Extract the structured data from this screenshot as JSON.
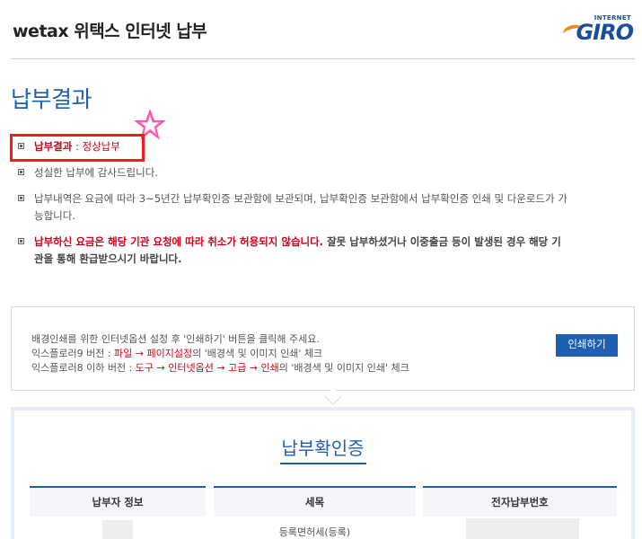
{
  "header": {
    "title": "wetax 위택스 인터넷 납부",
    "logo_small": "INTERNET",
    "logo_main": "GIRO"
  },
  "page_title": "납부결과",
  "result": {
    "label": "납부결과",
    "separator": " : ",
    "value": "정상납부"
  },
  "notes": [
    "성실한 납부에 감사드립니다.",
    "납부내역은 요금에 따라 3~5년간 납부확인증 보관함에 보관되며, 납부확인증 보관함에서 납부확인증 인쇄 및 다운로드가 가",
    "능합니다."
  ],
  "warning": {
    "part1": "납부하신 요금은 해당 기관 요청에 따라 취소가 허용되지 않습니다.",
    "part2": " 잘못 납부하셨거나 이중출금 등이 발생된 경우 해당 기",
    "part3": "관을 통해 환급받으시기 바랍니다."
  },
  "print_box": {
    "line1": "배경인쇄를 위한 인터넷옵션 설정 후 '인쇄하기' 버튼을 클릭해 주세요.",
    "line2_prefix": "익스플로러9 버전 : ",
    "line2_path": "파일 → 페이지설정",
    "line2_suffix": "의 '배경색 및 이미지 인쇄' 체크",
    "line3_prefix": "익스플로러8 이하 버전 : ",
    "line3_path": "도구 → 인터넷옵션 → 고급 → 인쇄",
    "line3_suffix": "의 '배경색 및 이미지 인쇄' 체크",
    "button_label": "인쇄하기"
  },
  "certificate": {
    "title": "납부확인증",
    "columns": [
      "납부자 정보",
      "세목",
      "전자납부번호"
    ],
    "tax_item": "등록면허세(등록)"
  },
  "colors": {
    "accent_blue": "#1f5fb0",
    "alert_red": "#d0021b",
    "highlight_red": "#ff1a1a",
    "star_pink": "#ff4fa8"
  }
}
